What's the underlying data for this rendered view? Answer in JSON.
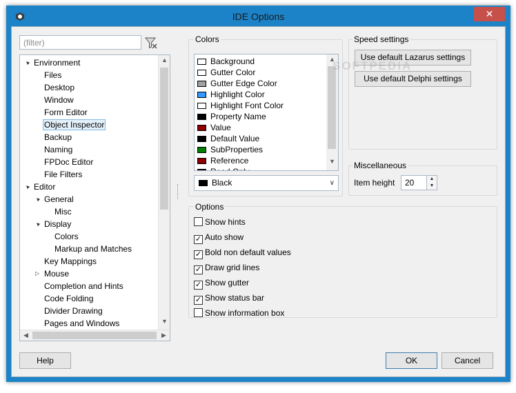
{
  "window": {
    "title": "IDE Options",
    "close_glyph": "✕"
  },
  "filter": {
    "placeholder": "(filter)"
  },
  "tree": [
    {
      "label": "Environment",
      "level": 0,
      "expander": "▲"
    },
    {
      "label": "Files",
      "level": 1
    },
    {
      "label": "Desktop",
      "level": 1
    },
    {
      "label": "Window",
      "level": 1
    },
    {
      "label": "Form Editor",
      "level": 1
    },
    {
      "label": "Object Inspector",
      "level": 1,
      "selected": true
    },
    {
      "label": "Backup",
      "level": 1
    },
    {
      "label": "Naming",
      "level": 1
    },
    {
      "label": "FPDoc Editor",
      "level": 1
    },
    {
      "label": "File Filters",
      "level": 1
    },
    {
      "label": "Editor",
      "level": 0,
      "expander": "▲"
    },
    {
      "label": "General",
      "level": 1,
      "expander": "▲"
    },
    {
      "label": "Misc",
      "level": 2
    },
    {
      "label": "Display",
      "level": 1,
      "expander": "▲"
    },
    {
      "label": "Colors",
      "level": 2
    },
    {
      "label": "Markup and Matches",
      "level": 2
    },
    {
      "label": "Key Mappings",
      "level": 1
    },
    {
      "label": "Mouse",
      "level": 1,
      "expander": "▷"
    },
    {
      "label": "Completion and Hints",
      "level": 1
    },
    {
      "label": "Code Folding",
      "level": 1
    },
    {
      "label": "Divider Drawing",
      "level": 1
    },
    {
      "label": "Pages and Windows",
      "level": 1
    }
  ],
  "colors_group": {
    "title": "Colors",
    "items": [
      {
        "label": "Background",
        "color": "#ffffff"
      },
      {
        "label": "Gutter Color",
        "color": "#ffffff"
      },
      {
        "label": "Gutter Edge Color",
        "color": "#a0a0a0"
      },
      {
        "label": "Highlight Color",
        "color": "#3399ff"
      },
      {
        "label": "Highlight Font Color",
        "color": "#ffffff"
      },
      {
        "label": "Property Name",
        "color": "#000000"
      },
      {
        "label": "Value",
        "color": "#8b0000"
      },
      {
        "label": "Default Value",
        "color": "#000000"
      },
      {
        "label": "SubProperties",
        "color": "#008000"
      },
      {
        "label": "Reference",
        "color": "#8b0000"
      },
      {
        "label": "Read Only",
        "color": "#000000"
      }
    ],
    "selected_color": {
      "label": "Black",
      "color": "#000000"
    }
  },
  "speed_group": {
    "title": "Speed settings",
    "lazarus_button": "Use default Lazarus settings",
    "delphi_button": "Use default Delphi settings"
  },
  "misc_group": {
    "title": "Miscellaneous",
    "item_height_label": "Item height",
    "item_height_value": "20"
  },
  "options_group": {
    "title": "Options",
    "checks": [
      {
        "label": "Show hints",
        "checked": false
      },
      {
        "label": "Auto show",
        "checked": true
      },
      {
        "label": "Bold non default values",
        "checked": true
      },
      {
        "label": "Draw grid lines",
        "checked": true
      },
      {
        "label": "Show gutter",
        "checked": true
      },
      {
        "label": "Show status bar",
        "checked": true
      },
      {
        "label": "Show information box",
        "checked": false
      }
    ]
  },
  "footer": {
    "help": "Help",
    "ok": "OK",
    "cancel": "Cancel"
  },
  "watermark": "SOFTPEDIA"
}
